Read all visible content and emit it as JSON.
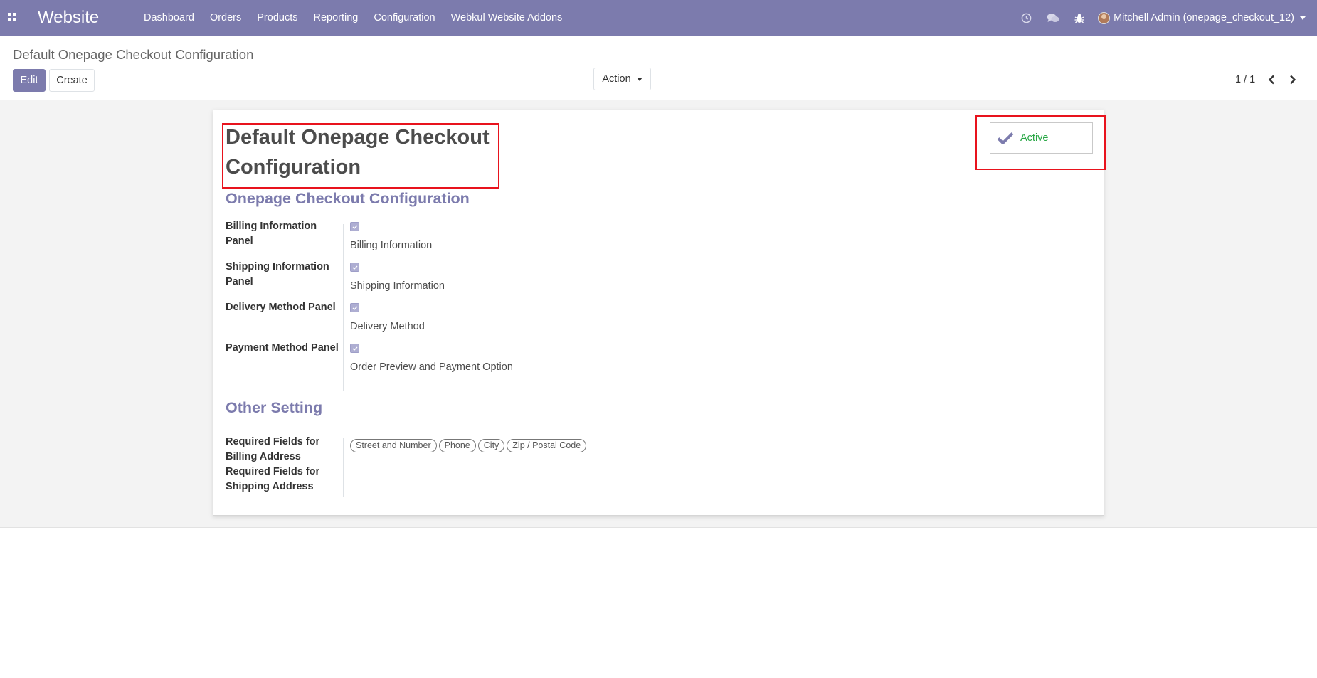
{
  "navbar": {
    "brand": "Website",
    "menu": [
      "Dashboard",
      "Orders",
      "Products",
      "Reporting",
      "Configuration",
      "Webkul Website Addons"
    ],
    "user": "Mitchell Admin (onepage_checkout_12)",
    "color": "#7c7bad"
  },
  "control_panel": {
    "breadcrumb": "Default Onepage Checkout Configuration",
    "edit_label": "Edit",
    "create_label": "Create",
    "action_label": "Action",
    "pager": "1 / 1"
  },
  "form": {
    "title": "Default Onepage Checkout Configuration",
    "active_label": "Active",
    "group1_title": "Onepage Checkout Configuration",
    "fields": [
      {
        "label": "Billing Information Panel",
        "checked": true,
        "text": "Billing Information"
      },
      {
        "label": "Shipping Information Panel",
        "checked": true,
        "text": "Shipping Information"
      },
      {
        "label": "Delivery Method Panel",
        "checked": true,
        "text": "Delivery Method"
      },
      {
        "label": "Payment Method Panel",
        "checked": true,
        "text": "Order Preview and Payment Option"
      }
    ],
    "group2_title": "Other Setting",
    "billing_required_label": "Required Fields for Billing Address",
    "shipping_required_label": "Required Fields for Shipping Address",
    "billing_required_tags": [
      "Street and Number",
      "Phone",
      "City",
      "Zip / Postal Code"
    ]
  }
}
